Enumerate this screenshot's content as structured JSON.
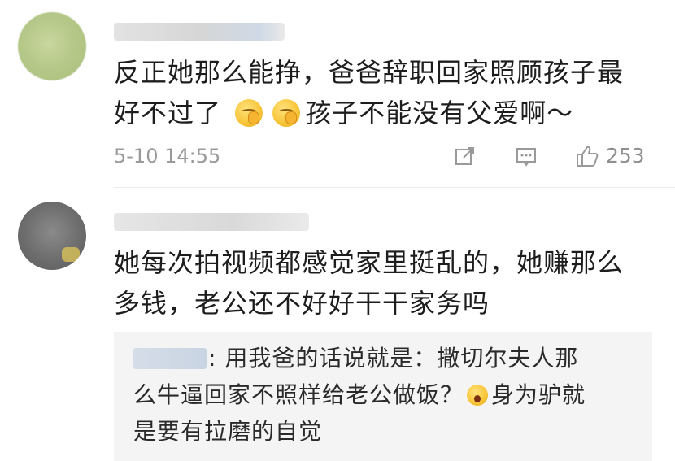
{
  "comments": [
    {
      "text_lines": [
        "反正她那么能挣，爸爸辞职回家照顾孩子最",
        "好不过了"
      ],
      "text_after_emoji": "孩子不能没有父爱啊～",
      "emoji": [
        "shh-face-emoji",
        "shh-face-emoji"
      ],
      "timestamp": "5-10 14:55",
      "like_count": "253"
    },
    {
      "text_lines": [
        "她每次拍视频都感觉家里挺乱的，她赚那么",
        "多钱，老公还不好好干干家务吗"
      ],
      "reply": {
        "line1": ": 用我爸的话说就是：撒切尔夫人那",
        "line2_before_emoji": "么牛逼回家不照样给老公做饭？",
        "line2_after_emoji": "身为驴就",
        "line3": "是要有拉磨的自觉",
        "emoji": "yawning-face-emoji"
      }
    }
  ]
}
